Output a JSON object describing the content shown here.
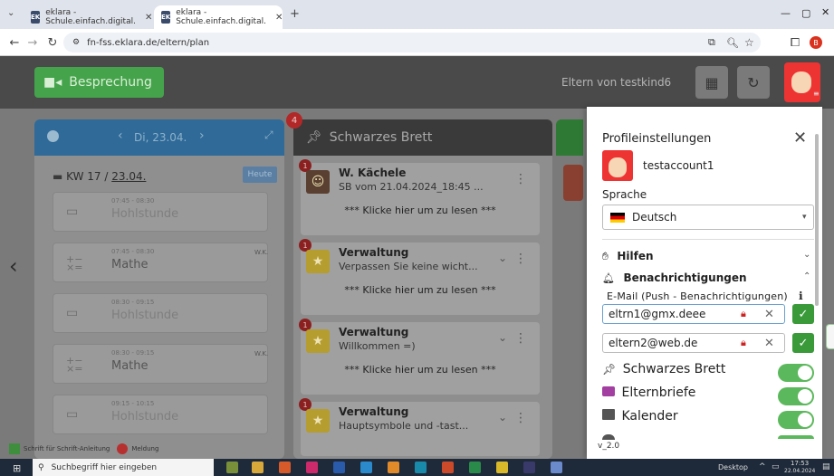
{
  "browser": {
    "tabs": [
      {
        "label": "eklara - Schule.einfach.digital.",
        "active": false
      },
      {
        "label": "eklara - Schule.einfach.digital.",
        "active": true
      }
    ],
    "new_tab": "+",
    "url": "fn-fss.eklara.de/eltern/plan",
    "favicon": "EK",
    "avatar_letter": "B"
  },
  "appbar": {
    "besprechung_label": "Besprechung",
    "eltern_von": "Eltern von testkind6"
  },
  "plan": {
    "date_label": "Di, 23.04.",
    "week_label": "KW 17 / ",
    "week_date": "23.04.",
    "today_button": "Heute",
    "slots": [
      {
        "time": "07:45 - 08:30",
        "subject": "Hohlstunde",
        "wk": "",
        "free": true
      },
      {
        "time": "07:45 - 08:30",
        "subject": "Mathe",
        "wk": "W.K.",
        "free": false
      },
      {
        "time": "08:30 - 09:15",
        "subject": "Hohlstunde",
        "wk": "",
        "free": true
      },
      {
        "time": "08:30 - 09:15",
        "subject": "Mathe",
        "wk": "W.K.",
        "free": false
      },
      {
        "time": "09:15 - 10:15",
        "subject": "Hohlstunde",
        "wk": "",
        "free": true
      }
    ],
    "legend": [
      "Schrift für Schrift-Anleitung",
      "Meldung"
    ]
  },
  "brett": {
    "title": "Schwarzes Brett",
    "count_badge": "4",
    "cards": [
      {
        "title": "W. Kächele",
        "subtitle": "SB vom 21.04.2024_18:45 ...",
        "badge": "1",
        "read": "*** Klicke hier um zu lesen ***"
      },
      {
        "title": "Verwaltung",
        "subtitle": "Verpassen Sie keine wicht...",
        "badge": "1",
        "read": "*** Klicke hier um zu lesen ***"
      },
      {
        "title": "Verwaltung",
        "subtitle": "Willkommen =)",
        "badge": "1",
        "read": "*** Klicke hier um zu lesen ***"
      },
      {
        "title": "Verwaltung",
        "subtitle": "Hauptsymbole und -tast...",
        "badge": "1",
        "read": ""
      }
    ]
  },
  "profile": {
    "title": "Profileinstellungen",
    "account": "testaccount1",
    "language_label": "Sprache",
    "language_value": "Deutsch",
    "hilfen": "Hilfen",
    "benachrichtigungen": "Benachrichtigungen",
    "email_label": "E-Mail (Push - Benachrichtigungen)",
    "emails": [
      "eltrn1@gmx.deee",
      "eltern2@web.de"
    ],
    "toggles": [
      {
        "label": "Schwarzes Brett",
        "on": true
      },
      {
        "label": "Elternbriefe",
        "on": true
      },
      {
        "label": "Kalender",
        "on": true
      }
    ],
    "version": "v_2.0"
  },
  "taskbar": {
    "search_placeholder": "Suchbegriff hier eingeben",
    "desktop": "Desktop",
    "time": "17:53",
    "date": "22.04.2024"
  }
}
